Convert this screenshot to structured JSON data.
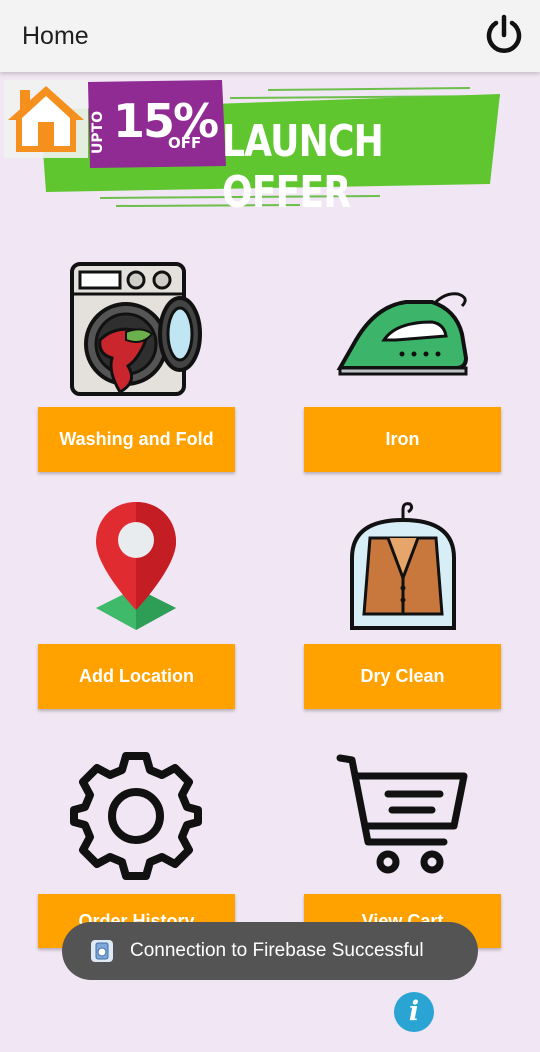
{
  "appbar": {
    "title": "Home",
    "power_icon": "power-icon"
  },
  "banner": {
    "upto": "UPTO",
    "percent": "15%",
    "off": "OFF",
    "headline": "LAUNCH OFFER",
    "home_icon": "home-icon",
    "colors": {
      "green": "#5fc630",
      "purple": "#8f2b93",
      "orange": "#f5901e"
    }
  },
  "services": [
    {
      "label": "Washing and Fold",
      "icon": "washing-machine-icon"
    },
    {
      "label": "Iron",
      "icon": "iron-icon"
    },
    {
      "label": "Add Location",
      "icon": "location-pin-icon"
    },
    {
      "label": "Dry Clean",
      "icon": "suit-icon"
    },
    {
      "label": "Order History",
      "icon": "gear-icon"
    },
    {
      "label": "View Cart",
      "icon": "cart-icon"
    }
  ],
  "toast": {
    "text": "Connection to Firebase Successful",
    "icon": "app-icon"
  },
  "info_button": {
    "icon": "info-icon",
    "symbol": "i"
  },
  "theme": {
    "button_color": "#ffa200",
    "background": "#f1e6f3"
  }
}
